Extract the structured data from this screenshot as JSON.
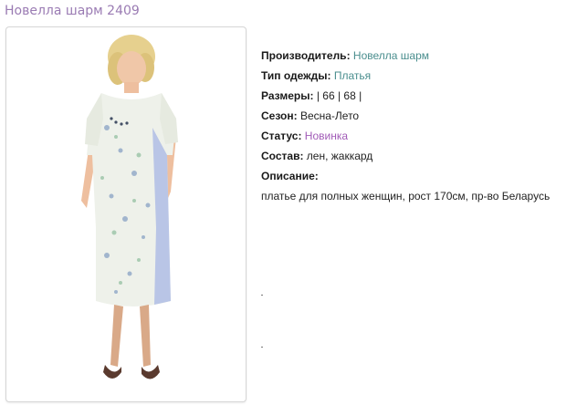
{
  "product": {
    "title": "Новелла шарм 2409"
  },
  "photo": {
    "icon": "dress-model-photo"
  },
  "properties": {
    "manufacturer_label": "Производитель:",
    "manufacturer_value": "Новелла шарм",
    "type_label": "Тип одежды:",
    "type_value": "Платья",
    "sizes_label": "Размеры:",
    "sizes_value": "| 66 | 68 |",
    "season_label": "Сезон:",
    "season_value": "Весна-Лето",
    "status_label": "Статус:",
    "status_value": "Новинка",
    "composition_label": "Состав:",
    "composition_value": "лен, жаккард",
    "description_label": "Описание:",
    "description_value": "платье для полных женщин, рост 170см, пр-во Беларусь"
  },
  "colors": {
    "title": "#9a7bb3",
    "link": "#4a8e8e",
    "status": "#a15bb7"
  }
}
